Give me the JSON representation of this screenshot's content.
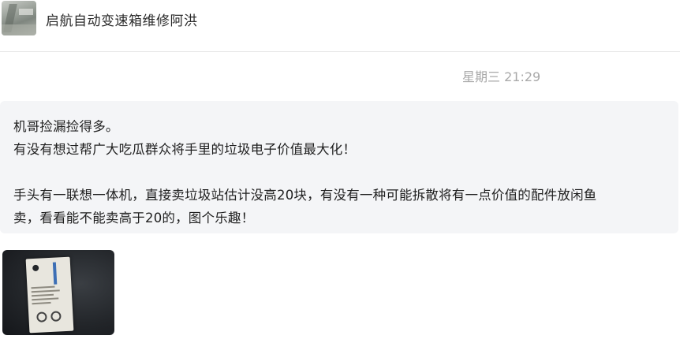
{
  "header": {
    "contact_name": "启航自动变速箱维修阿洪"
  },
  "timestamp": "星期三 21:29",
  "message": {
    "lines": [
      "机哥捡漏捡得多。",
      "有没有想过帮广大吃瓜群众将手里的垃圾电子价值最大化！",
      "",
      "手头有一联想一体机，直接卖垃圾站估计没高20块，有没有一种可能拆散将有一点价值的配件放闲鱼",
      "卖，看看能不能卖高于20的，图个乐趣！"
    ]
  }
}
